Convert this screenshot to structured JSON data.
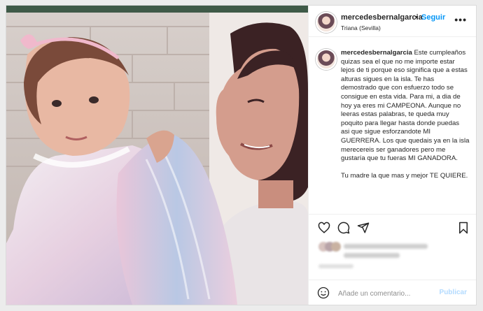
{
  "post": {
    "username": "mercedesbernalgarcia",
    "separator": "•",
    "follow_label": "Seguir",
    "location": "Triana (Sevilla)",
    "more_label": "•••",
    "caption_username": "mercedesbernalgarcia",
    "caption_text": " Este cumpleaños quizas sea el que no me importe estar lejos de ti porque eso significa que a estas alturas sigues en la isla. Te has demostrado que con esfuerzo todo se consigue en esta vida. Para mi, a dia de hoy ya eres mi CAMPEONA. Aunque no leeras estas palabras, te queda muy poquito para llegar hasta donde puedas asi que sigue esforzandote MI GUERRERA. Los que quedais ya en la isla merecereis ser ganadores pero me gustaría que tu fueras MI GANADORA.\n\nTu madre la que mas y mejor TE QUIERE.",
    "icons": [
      "heart-icon",
      "comment-icon",
      "share-icon",
      "bookmark-icon",
      "emoji-icon",
      "more-icon"
    ]
  },
  "comment": {
    "placeholder": "Añade un comentario...",
    "publish_label": "Publicar"
  },
  "colors": {
    "accent": "#0095f6",
    "publish_disabled": "#b3dbff",
    "border": "#dbdbdb"
  }
}
